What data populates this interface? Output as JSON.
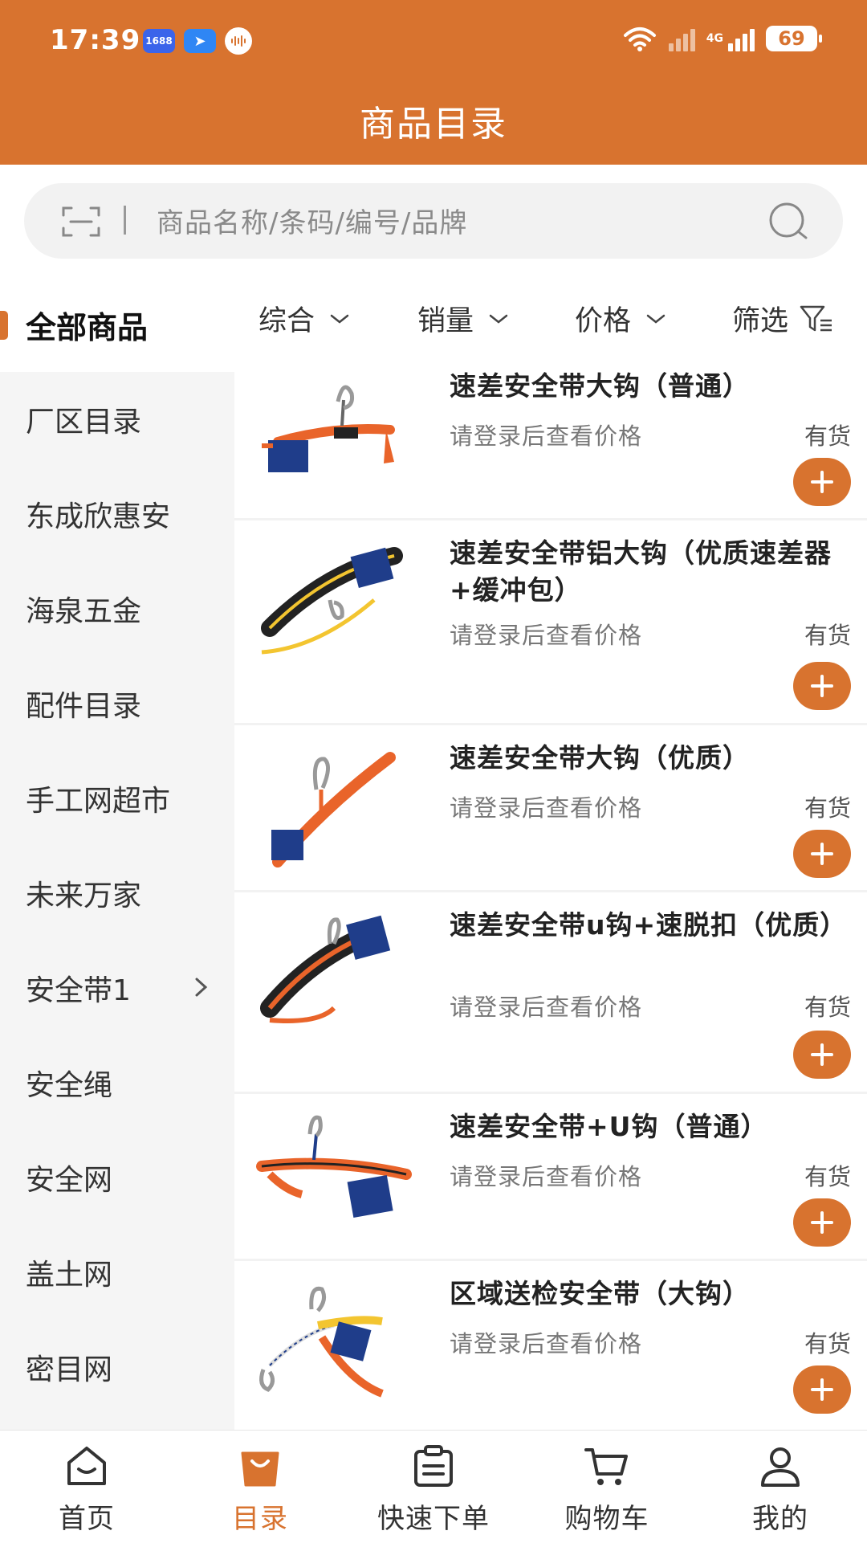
{
  "status_bar": {
    "time": "17:39",
    "app_badge": "1688",
    "network": "4G",
    "battery": "69"
  },
  "header": {
    "title": "商品目录"
  },
  "search": {
    "placeholder": "商品名称/条码/编号/品牌"
  },
  "sidebar": {
    "items": [
      {
        "label": "全部商品",
        "active": true
      },
      {
        "label": "厂区目录"
      },
      {
        "label": "东成欣惠安"
      },
      {
        "label": "海泉五金"
      },
      {
        "label": "配件目录"
      },
      {
        "label": "手工网超市"
      },
      {
        "label": "未来万家"
      },
      {
        "label": "安全带1",
        "has_children": true
      },
      {
        "label": "安全绳"
      },
      {
        "label": "安全网"
      },
      {
        "label": "盖土网"
      },
      {
        "label": "密目网"
      }
    ]
  },
  "filters": [
    {
      "label": "综合",
      "icon": "chevron-down-icon"
    },
    {
      "label": "销量",
      "icon": "chevron-down-icon"
    },
    {
      "label": "价格",
      "icon": "chevron-down-icon"
    },
    {
      "label": "筛选",
      "icon": "filter-icon"
    }
  ],
  "products": [
    {
      "name": "速差安全带大钩（普通）",
      "price_text": "请登录后查看价格",
      "stock": "有货"
    },
    {
      "name": "速差安全带铝大钩（优质速差器+缓冲包）",
      "price_text": "请登录后查看价格",
      "stock": "有货"
    },
    {
      "name": "速差安全带大钩（优质）",
      "price_text": "请登录后查看价格",
      "stock": "有货"
    },
    {
      "name": "速差安全带u钩+速脱扣（优质）",
      "price_text": "请登录后查看价格",
      "stock": "有货"
    },
    {
      "name": "速差安全带+U钩（普通）",
      "price_text": "请登录后查看价格",
      "stock": "有货"
    },
    {
      "name": "区域送检安全带（大钩）",
      "price_text": "请登录后查看价格",
      "stock": "有货"
    }
  ],
  "bottom_nav": [
    {
      "label": "首页",
      "icon": "home-icon"
    },
    {
      "label": "目录",
      "icon": "catalog-bag-icon",
      "active": true
    },
    {
      "label": "快速下单",
      "icon": "clipboard-icon"
    },
    {
      "label": "购物车",
      "icon": "cart-icon"
    },
    {
      "label": "我的",
      "icon": "user-icon"
    }
  ],
  "colors": {
    "accent": "#d8732f",
    "sidebar_bg": "#f5f5f5",
    "divider": "#f2f2f2"
  }
}
